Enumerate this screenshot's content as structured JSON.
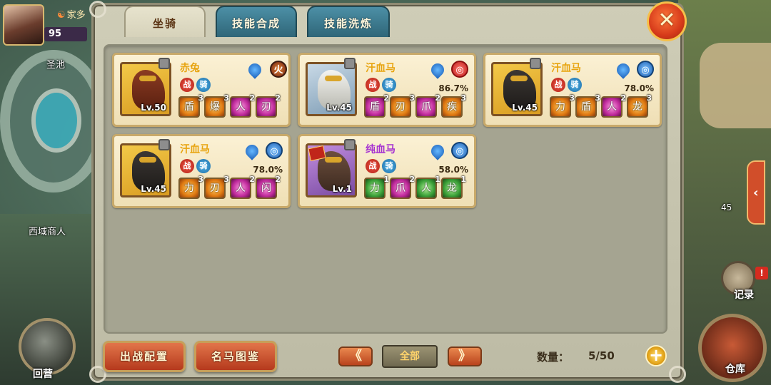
{
  "background": {
    "location_label": "圣池",
    "merchant_label": "西域商人",
    "right_level": "45"
  },
  "player": {
    "name": "家多",
    "level": "95"
  },
  "side_buttons": {
    "camp_label": "回营",
    "record_label": "记录",
    "record_badge": "!",
    "store_label": "仓库"
  },
  "tabs": [
    {
      "label": "坐骑",
      "active": true
    },
    {
      "label": "技能合成",
      "active": false
    },
    {
      "label": "技能洗炼",
      "active": false
    }
  ],
  "close_icon": "✕",
  "mounts": [
    {
      "name": "赤兔",
      "name_color": "gold",
      "level": "Lv.50",
      "portrait": "gold",
      "horse": "red",
      "element": "fire",
      "element_glyph": "火",
      "percent": "",
      "status": [
        {
          "glyph": "战",
          "color": "red"
        },
        {
          "glyph": "骑",
          "color": "blue"
        }
      ],
      "skills": [
        {
          "color": "orange",
          "glyph": "盾",
          "count": "3"
        },
        {
          "color": "orange",
          "glyph": "爆",
          "count": "3"
        },
        {
          "color": "pink",
          "glyph": "人",
          "count": "2"
        },
        {
          "color": "pink",
          "glyph": "刃",
          "count": "2"
        }
      ]
    },
    {
      "name": "汗血马",
      "name_color": "gold",
      "level": "Lv.45",
      "portrait": "steel",
      "horse": "white",
      "element": "red-orb",
      "element_glyph": "◎",
      "percent": "86.7%",
      "status": [
        {
          "glyph": "战",
          "color": "red"
        },
        {
          "glyph": "骑",
          "color": "blue"
        }
      ],
      "skills": [
        {
          "color": "pink",
          "glyph": "盾",
          "count": "2"
        },
        {
          "color": "orange",
          "glyph": "刃",
          "count": "3"
        },
        {
          "color": "pink",
          "glyph": "爪",
          "count": "2"
        },
        {
          "color": "orange",
          "glyph": "疾",
          "count": "3"
        }
      ]
    },
    {
      "name": "汗血马",
      "name_color": "gold",
      "level": "Lv.45",
      "portrait": "gold",
      "horse": "black",
      "element": "blue-orb",
      "element_glyph": "◎",
      "percent": "78.0%",
      "status": [
        {
          "glyph": "战",
          "color": "red"
        },
        {
          "glyph": "骑",
          "color": "blue"
        }
      ],
      "skills": [
        {
          "color": "orange",
          "glyph": "力",
          "count": "3"
        },
        {
          "color": "orange",
          "glyph": "盾",
          "count": "3"
        },
        {
          "color": "pink",
          "glyph": "人",
          "count": "2"
        },
        {
          "color": "orange",
          "glyph": "龙",
          "count": "3"
        }
      ]
    },
    {
      "name": "汗血马",
      "name_color": "gold",
      "level": "Lv.45",
      "portrait": "gold",
      "horse": "black",
      "element": "blue-orb",
      "element_glyph": "◎",
      "percent": "78.0%",
      "status": [
        {
          "glyph": "战",
          "color": "red"
        },
        {
          "glyph": "骑",
          "color": "blue"
        }
      ],
      "skills": [
        {
          "color": "orange",
          "glyph": "力",
          "count": "3"
        },
        {
          "color": "orange",
          "glyph": "刃",
          "count": "3"
        },
        {
          "color": "pink",
          "glyph": "人",
          "count": "2"
        },
        {
          "color": "pink",
          "glyph": "闪",
          "count": "2"
        }
      ]
    },
    {
      "name": "纯血马",
      "name_color": "purple",
      "level": "Lv.1",
      "portrait": "purple",
      "horse": "brown",
      "element": "blue-orb",
      "element_glyph": "◎",
      "percent": "58.0%",
      "new": true,
      "status": [
        {
          "glyph": "战",
          "color": "red"
        },
        {
          "glyph": "骑",
          "color": "blue"
        }
      ],
      "skills": [
        {
          "color": "green",
          "glyph": "力",
          "count": "1"
        },
        {
          "color": "pink",
          "glyph": "爪",
          "count": "2"
        },
        {
          "color": "green",
          "glyph": "人",
          "count": "1"
        },
        {
          "color": "green",
          "glyph": "龙",
          "count": "1"
        }
      ]
    }
  ],
  "bottom": {
    "deploy_label": "出战配置",
    "catalog_label": "名马图鉴",
    "prev_label": "《",
    "filter_label": "全部",
    "next_label": "》",
    "count_label": "数量：",
    "count_value": "5/50",
    "add_label": "+"
  }
}
